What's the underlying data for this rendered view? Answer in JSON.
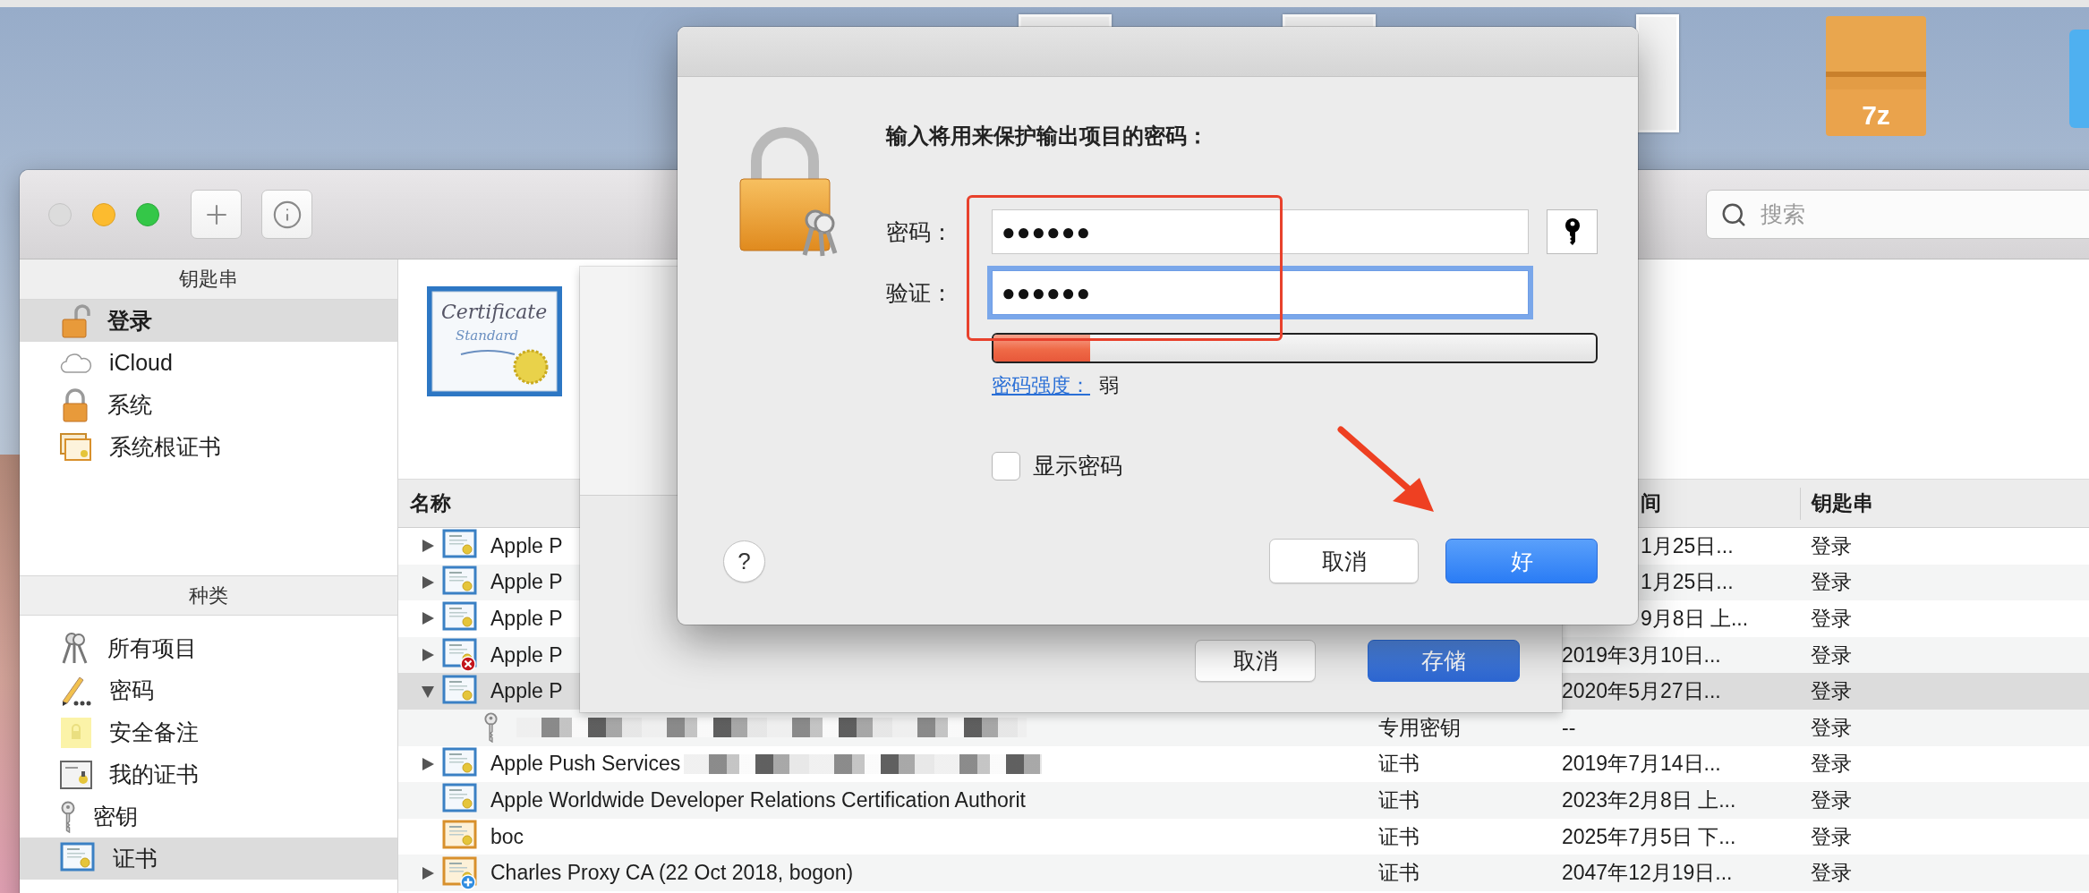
{
  "desktop": {
    "file_icon_label": "7z"
  },
  "keychain_window": {
    "toolbar": {
      "search": {
        "placeholder": "搜索"
      }
    },
    "sidebar": {
      "sections": [
        {
          "title": "钥匙串",
          "items": [
            {
              "label": "登录",
              "selected": true
            },
            {
              "label": "iCloud",
              "selected": false
            },
            {
              "label": "系统",
              "selected": false
            },
            {
              "label": "系统根证书",
              "selected": false
            }
          ]
        },
        {
          "title": "种类",
          "items": [
            {
              "label": "所有项目",
              "selected": false
            },
            {
              "label": "密码",
              "selected": false
            },
            {
              "label": "安全备注",
              "selected": false
            },
            {
              "label": "我的证书",
              "selected": false
            },
            {
              "label": "密钥",
              "selected": false
            },
            {
              "label": "证书",
              "selected": true
            }
          ]
        }
      ]
    },
    "preview": {
      "icon_title": "Certificate",
      "icon_subtitle": "Standard"
    },
    "table": {
      "header": {
        "name": "名称",
        "column_3": "间",
        "keychain": "钥匙串"
      },
      "rows": [
        {
          "kind": "cert",
          "expanded": false,
          "selected": false,
          "name": "Apple P",
          "column_3": "1月25日...",
          "keychain": "登录"
        },
        {
          "kind": "cert",
          "expanded": false,
          "selected": false,
          "name": "Apple P",
          "column_3": "1月25日...",
          "keychain": "登录"
        },
        {
          "kind": "cert",
          "expanded": false,
          "selected": false,
          "name": "Apple P",
          "column_3": "9月8日 上...",
          "keychain": "登录"
        },
        {
          "kind": "cert_error",
          "expanded": false,
          "selected": false,
          "name": "Apple P",
          "column_3": "2019年3月10日...",
          "keychain": "登录"
        },
        {
          "kind": "cert",
          "expanded": true,
          "selected": true,
          "name": "Apple P",
          "column_3": "2020年5月27日...",
          "keychain": "登录"
        },
        {
          "kind": "key",
          "selected": false,
          "redacted": true,
          "column_2": "专用密钥",
          "column_3": "--",
          "keychain": "登录"
        },
        {
          "kind": "cert",
          "expanded": false,
          "selected": false,
          "name": "Apple Push Services",
          "redacted": true,
          "column_2": "证书",
          "column_3": "2019年7月14日...",
          "keychain": "登录"
        },
        {
          "kind": "cert",
          "selected": false,
          "name": "Apple Worldwide Developer Relations Certification Authorit",
          "column_2": "证书",
          "column_3": "2023年2月8日 上...",
          "keychain": "登录"
        },
        {
          "kind": "cert_orange",
          "selected": false,
          "name": "boc",
          "column_2": "证书",
          "column_3": "2025年7月5日 下...",
          "keychain": "登录"
        },
        {
          "kind": "cert_orange_add",
          "expanded": false,
          "selected": false,
          "name": "Charles Proxy CA (22 Oct 2018, bogon)",
          "column_2": "证书",
          "column_3": "2047年12月19日...",
          "keychain": "登录"
        }
      ]
    }
  },
  "save_sheet": {
    "buttons": [
      {
        "label": "取消",
        "default": false
      },
      {
        "label": "存储",
        "default": true
      }
    ]
  },
  "export_dialog": {
    "prompt": "输入将用来保护输出项目的密码：",
    "fields": [
      {
        "label": "密码：",
        "value": "●●●●●●",
        "focused": false
      },
      {
        "label": "验证：",
        "value": "●●●●●●",
        "focused": true
      }
    ],
    "strength": {
      "level": 0.16,
      "link": "密码强度：",
      "value": "弱"
    },
    "show_password": {
      "label": "显示密码",
      "checked": false
    },
    "help": "?",
    "buttons": [
      {
        "label": "取消",
        "default": false
      },
      {
        "label": "好",
        "default": true
      }
    ]
  }
}
